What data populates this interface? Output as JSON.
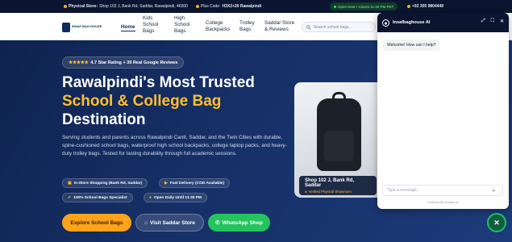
{
  "topbar": {
    "store_label": "Physical Store:",
    "store_address": "Shop 102 J, Bank Rd, Saddar, Rawalpindi, 46000",
    "plus_code_label": "Plus Code:",
    "plus_code": "H3X2+26 Rawalpindi",
    "open_status": "Open Now • Closes 11:30 PM PKT",
    "phone": "+92 305 9804449"
  },
  "nav": {
    "logo_text": "INSAF BAG HOUSE",
    "items": [
      {
        "label": "Home"
      },
      {
        "label": "Kids School Bags"
      },
      {
        "label": "High School Bags"
      },
      {
        "label": "College Backpacks"
      },
      {
        "label": "Trolley Bags"
      },
      {
        "label": "Saddar Store & Reviews"
      }
    ],
    "search_placeholder": "Search school bags..."
  },
  "hero": {
    "rating_text": "4.7 Star Rating + 39 Real Google Reviews",
    "title_line1": "Rawalpindi's Most Trusted",
    "title_line2": "School & College Bag",
    "title_line3": "Destination",
    "description": "Serving students and parents across Rawalpindi Cantt, Saddar, and the Twin Cities with durable, spine-cushioned school bags, waterproof high school backpacks, college laptop packs, and heavy-duty trolley bags. Tested for lasting durability through full academic sessions.",
    "chips": [
      {
        "label": "In-Store Shopping (Bank Rd, Saddar)",
        "icon": "store-icon"
      },
      {
        "label": "Fast Delivery (COD Available)",
        "icon": "truck-icon"
      },
      {
        "label": "100% School Bags Specialist",
        "icon": "badge-icon"
      },
      {
        "label": "Open Daily Until 11:30 PM",
        "icon": "clock-icon"
      }
    ],
    "buttons": {
      "explore": "Explore School Bags",
      "visit": "Visit Saddar Store",
      "whatsapp": "WhatsApp Shop"
    },
    "card": {
      "location": "Shop 102 J, Bank Rd, Saddar",
      "verified": "Verified Physical Showroom"
    }
  },
  "chat": {
    "title": "Insafbaghouse AI",
    "welcome": "Welcome! How can I help?",
    "input_placeholder": "Type a message...",
    "powered": "Powered by Zendesk AI"
  },
  "colors": {
    "accent_yellow": "#ffbf2e",
    "button_orange": "#ffa31a",
    "whatsapp_green": "#25c35f",
    "navy": "#0f2350"
  }
}
